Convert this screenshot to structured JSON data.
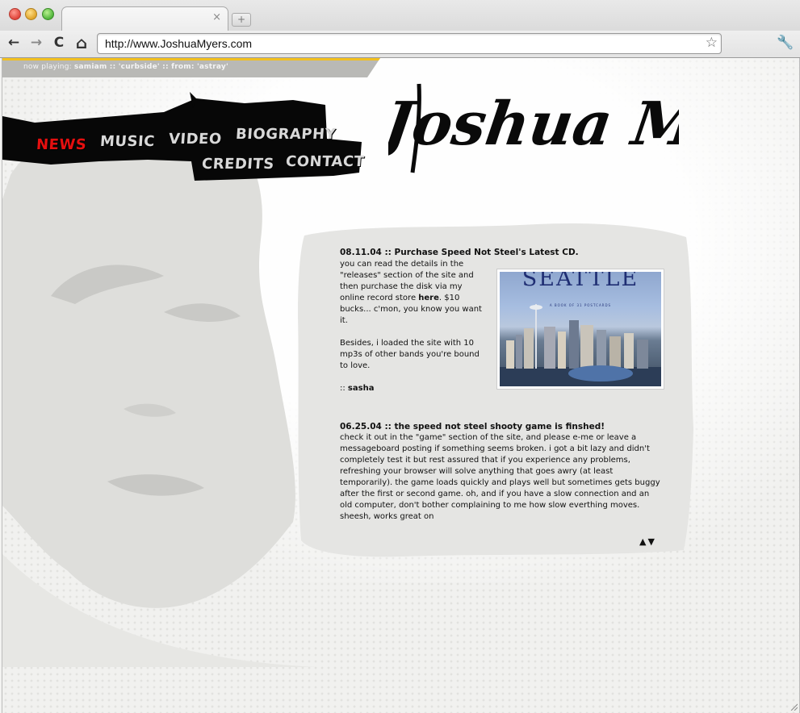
{
  "browser": {
    "url": "http://www.JoshuaMyers.com",
    "tab_close": "×",
    "new_tab": "+",
    "back": "←",
    "forward": "→",
    "reload": "C",
    "home": "⌂",
    "bookmark": "☆",
    "menu": "🔧"
  },
  "now_playing": {
    "label": "now playing:",
    "track": "samiam :: 'curbside' :: from: 'astray'"
  },
  "logo_text": "Joshua Myers",
  "nav": {
    "news": "NEWS",
    "music": "MUSIC",
    "video": "VIDEO",
    "biography": "BIOGRAPHY",
    "credits": "CREDITS",
    "contact": "CONTACT"
  },
  "posts": [
    {
      "title": "08.11.04 :: Purchase Speed Not Steel's Latest CD.",
      "body_1a": " you can read the details in the \"releases\" section of the site and then purchase the disk via my online record store ",
      "link": "here",
      "body_1b": ". $10 bucks... c'mon, you know you want it.",
      "body_2": "Besides, i loaded the site with 10 mp3s of other bands you're bound to love.",
      "sign_prefix": ":: ",
      "sign": "sasha",
      "image_title": "SEATTLE",
      "image_subtitle": "A BOOK OF 31 POSTCARDS"
    },
    {
      "title": "06.25.04 :: the speed not steel shooty game is finshed!",
      "body": "check it out in the \"game\" section of the site, and please e-me or leave a messageboard posting if something seems broken. i got a bit lazy and didn't completely test it but rest assured that if you experience any problems, refreshing your browser will solve anything that goes awry (at least temporarily). the game loads quickly and plays well but sometimes gets buggy after the first or second game. oh, and if you have a slow  connection and an old computer, don't bother complaining to me how slow everthing moves. sheesh, works great on"
    }
  ],
  "scroll": {
    "up": "▲",
    "down": "▼"
  }
}
